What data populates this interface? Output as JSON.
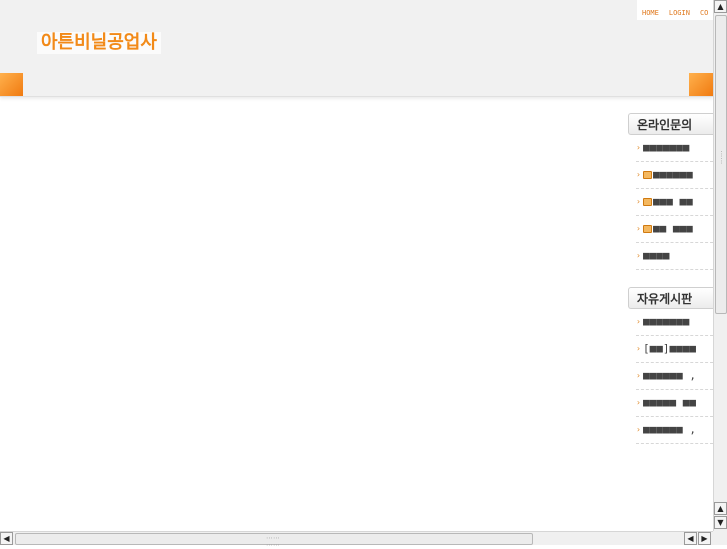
{
  "header": {
    "logo_text": "아튼비닐공업사",
    "nav": [
      "HOME",
      "LOGIN",
      "CO"
    ]
  },
  "online_inquiry": {
    "title": "온라인문의",
    "items": [
      {
        "text": "■■■■■■■",
        "locked": false
      },
      {
        "text": "■■■■■■",
        "locked": true
      },
      {
        "text": "■■■ ■■",
        "locked": true
      },
      {
        "text": "■■ ■■■",
        "locked": true
      },
      {
        "text": "■■■■",
        "locked": false
      }
    ]
  },
  "free_board": {
    "title": "자유게시판",
    "items": [
      {
        "text": "■■■■■■■"
      },
      {
        "text": "[■■]■■■■"
      },
      {
        "text": "■■■■■■ ,"
      },
      {
        "text": "■■■■■ ■■"
      },
      {
        "text": "■■■■■■ ,"
      }
    ]
  },
  "colors": {
    "brand_orange": "#f28a18",
    "header_bg": "#f1f1f1"
  },
  "icons": {
    "bullet": "bullet-icon",
    "lock": "lock-icon"
  }
}
